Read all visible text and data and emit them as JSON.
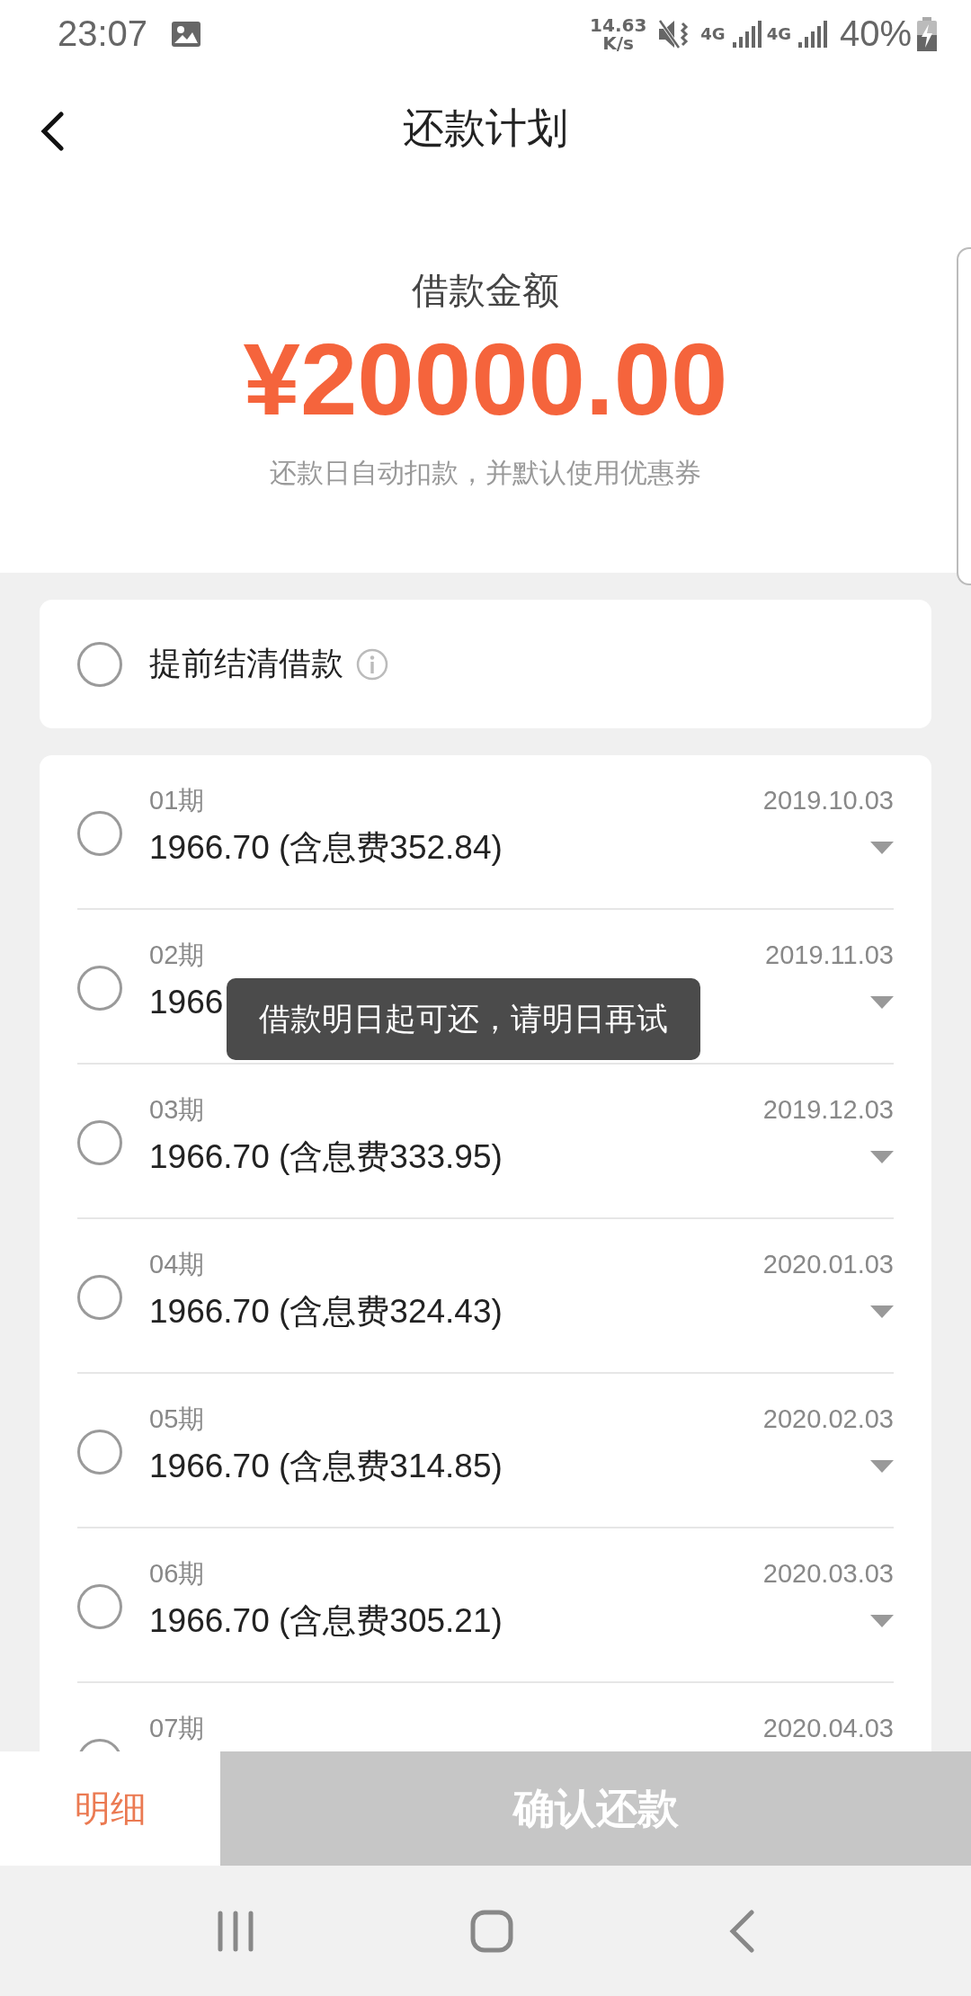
{
  "status_bar": {
    "time": "23:07",
    "speed_value": "14.63",
    "speed_unit": "K/s",
    "network_labels": [
      "4G",
      "4G"
    ],
    "battery": "40%"
  },
  "header": {
    "title": "还款计划"
  },
  "summary": {
    "label": "借款金额",
    "amount": "¥20000.00",
    "note": "还款日自动扣款，并默认使用优惠券"
  },
  "payoff": {
    "label": "提前结清借款",
    "selected": false
  },
  "installments": [
    {
      "period": "01期",
      "amount": "1966.70 (含息费352.84)",
      "date": "2019.10.03",
      "selected": false
    },
    {
      "period": "02期",
      "amount": "1966",
      "date": "2019.11.03",
      "selected": false
    },
    {
      "period": "03期",
      "amount": "1966.70 (含息费333.95)",
      "date": "2019.12.03",
      "selected": false
    },
    {
      "period": "04期",
      "amount": "1966.70 (含息费324.43)",
      "date": "2020.01.03",
      "selected": false
    },
    {
      "period": "05期",
      "amount": "1966.70 (含息费314.85)",
      "date": "2020.02.03",
      "selected": false
    },
    {
      "period": "06期",
      "amount": "1966.70 (含息费305.21)",
      "date": "2020.03.03",
      "selected": false
    },
    {
      "period": "07期",
      "date": "2020.04.03",
      "selected": false
    }
  ],
  "toast": "借款明日起可还，请明日再试",
  "bottom_bar": {
    "detail": "明细",
    "confirm": "确认还款",
    "confirm_disabled": true
  }
}
